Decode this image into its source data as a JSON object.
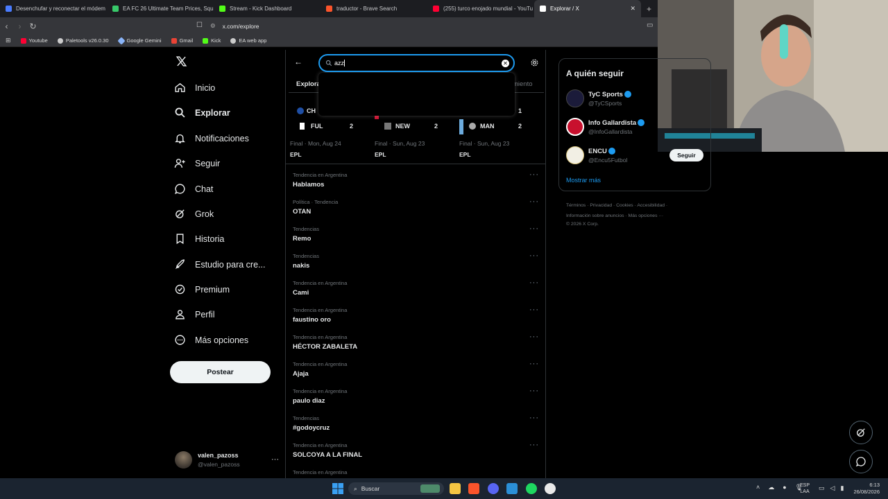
{
  "browser": {
    "tabs": [
      {
        "label": "Desenchufar y reconectar el módem",
        "color": "#4a7cff"
      },
      {
        "label": "EA FC 26 Ultimate Team Prices, Squa",
        "color": "#38c96a"
      },
      {
        "label": "Stream - Kick Dashboard",
        "color": "#53fc18"
      },
      {
        "label": "traductor - Brave Search",
        "color": "#fb542b"
      },
      {
        "label": "(255) turco enojado mundial - YouTu",
        "color": "#ff0033"
      },
      {
        "label": "Explorar / X",
        "color": "#ffffff"
      }
    ],
    "url": "x.com/explore",
    "bookmarks": [
      {
        "label": "Youtube",
        "color": "#ff0033"
      },
      {
        "label": "Paletools v26.0.30",
        "color": "#cccccc"
      },
      {
        "label": "Google Gemini",
        "color": "#8ab4f8"
      },
      {
        "label": "Gmail",
        "color": "#ea4335"
      },
      {
        "label": "Kick",
        "color": "#53fc18"
      },
      {
        "label": "EA web app",
        "color": "#cccccc"
      }
    ]
  },
  "sidebar": {
    "items": [
      {
        "label": "Inicio",
        "icon": "home-icon"
      },
      {
        "label": "Explorar",
        "icon": "search-icon"
      },
      {
        "label": "Notificaciones",
        "icon": "bell-icon"
      },
      {
        "label": "Seguir",
        "icon": "follow-icon"
      },
      {
        "label": "Chat",
        "icon": "chat-icon"
      },
      {
        "label": "Grok",
        "icon": "grok-icon"
      },
      {
        "label": "Historia",
        "icon": "bookmark-icon"
      },
      {
        "label": "Estudio para cre...",
        "icon": "rocket-icon"
      },
      {
        "label": "Premium",
        "icon": "verified-icon"
      },
      {
        "label": "Perfil",
        "icon": "user-icon"
      },
      {
        "label": "Más opciones",
        "icon": "more-circle-icon"
      }
    ],
    "post_label": "Postear",
    "account": {
      "name": "valen_pazoss",
      "handle": "@valen_pazoss"
    }
  },
  "main": {
    "search_value": "azz",
    "tab_left": "Explorar",
    "tab_right": "miento",
    "scores": [
      {
        "team_top": "CH",
        "team": "FUL",
        "goals": "2",
        "status": "Final",
        "date": "Mon, Aug 24",
        "league": "EPL"
      },
      {
        "team_top": "",
        "team": "NEW",
        "goals": "2",
        "status": "Final",
        "date": "Sun, Aug 23",
        "league": "EPL"
      },
      {
        "team_top": "",
        "team": "MAN",
        "goals": "2",
        "top_goals": "1",
        "status": "Final",
        "date": "Sun, Aug 23",
        "league": "EPL"
      }
    ],
    "trends": [
      {
        "meta": "Tendencia en Argentina",
        "name": "Hablamos"
      },
      {
        "meta": "Política · Tendencia",
        "name": "OTAN"
      },
      {
        "meta": "Tendencias",
        "name": "Remo"
      },
      {
        "meta": "Tendencias",
        "name": "nakis"
      },
      {
        "meta": "Tendencia en Argentina",
        "name": "Cami"
      },
      {
        "meta": "Tendencia en Argentina",
        "name": "faustino oro"
      },
      {
        "meta": "Tendencia en Argentina",
        "name": "HÉCTOR ZABALETA"
      },
      {
        "meta": "Tendencia en Argentina",
        "name": "Ajaja"
      },
      {
        "meta": "Tendencia en Argentina",
        "name": "paulo diaz"
      },
      {
        "meta": "Tendencias",
        "name": "#godoycruz"
      },
      {
        "meta": "Tendencia en Argentina",
        "name": "SOLCOYA A LA FINAL"
      },
      {
        "meta": "Tendencia en Argentina",
        "name": ""
      }
    ]
  },
  "right": {
    "title": "A quién seguir",
    "accounts": [
      {
        "name": "TyC Sports",
        "handle": "@TyCSports",
        "color": "#1b1b3a"
      },
      {
        "name": "Info Gallardista",
        "handle": "@InfoGallardista",
        "color": "#c8102e"
      },
      {
        "name": "ENCU",
        "handle": "@Encu5Futbol",
        "color": "#d8c27a"
      }
    ],
    "follow_label": "Seguir",
    "show_more": "Mostrar más",
    "footer_line1": "Términos · Privacidad · Cookies · Accesibilidad ·",
    "footer_line2": "Información sobre anuncios · Más opciones ···",
    "footer_line3": "© 2026 X Corp."
  },
  "taskbar": {
    "search": "Buscar",
    "lang_top": "ESP",
    "lang_bottom": "LAA",
    "time": "6:13",
    "date": "26/08/2026"
  }
}
